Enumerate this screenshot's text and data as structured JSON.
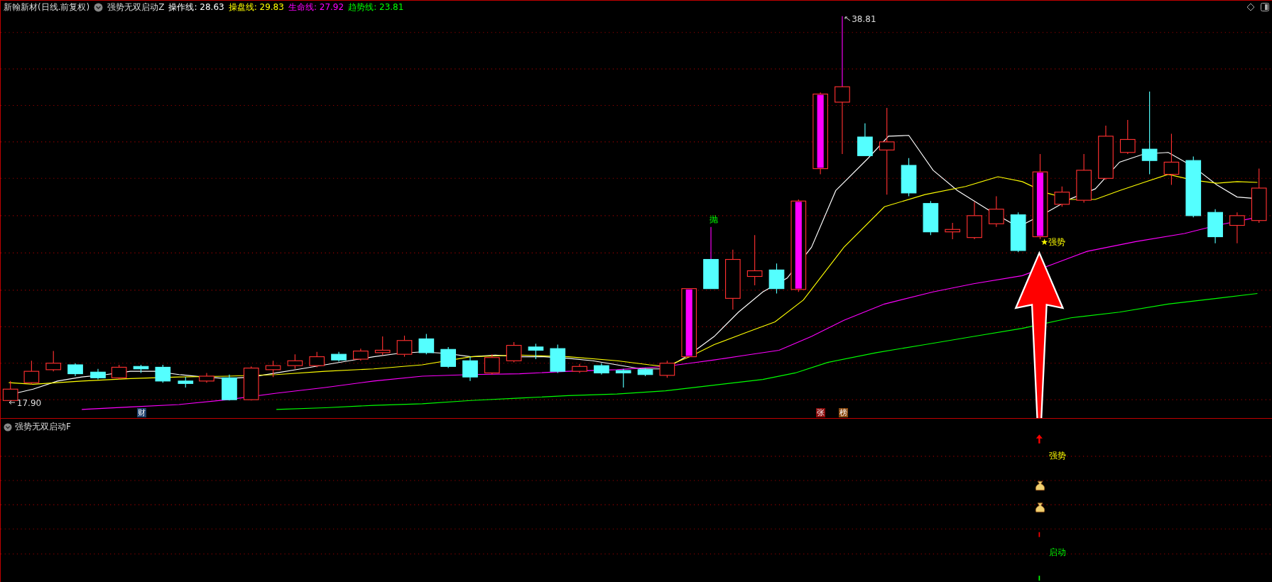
{
  "header": {
    "title": "新翰新材(日线.前复权)",
    "indicator": "强势无双启动Z",
    "lines": [
      {
        "label": "操作线:",
        "value": "28.63",
        "color": "#ffffff"
      },
      {
        "label": "操盘线:",
        "value": "29.83",
        "color": "#ffff00"
      },
      {
        "label": "生命线:",
        "value": "27.92",
        "color": "#ff00ff"
      },
      {
        "label": "趋势线:",
        "value": "23.81",
        "color": "#00ff00"
      }
    ]
  },
  "main_chart": {
    "high_label": "38.81",
    "low_label": "17.90",
    "signals": [
      {
        "text": "抛",
        "kind": "sell"
      },
      {
        "text": "★强势",
        "kind": "strong"
      }
    ],
    "badges": [
      {
        "text": "财",
        "color": "#1c3f6a"
      },
      {
        "text": "张",
        "color": "#8a0a0a"
      },
      {
        "text": "榜",
        "color": "#8a4a10"
      }
    ]
  },
  "sub_chart": {
    "title": "强势无双启动F",
    "signals": [
      {
        "text": "强势",
        "kind": "strong"
      },
      {
        "text": "启动",
        "kind": "start"
      }
    ]
  }
}
